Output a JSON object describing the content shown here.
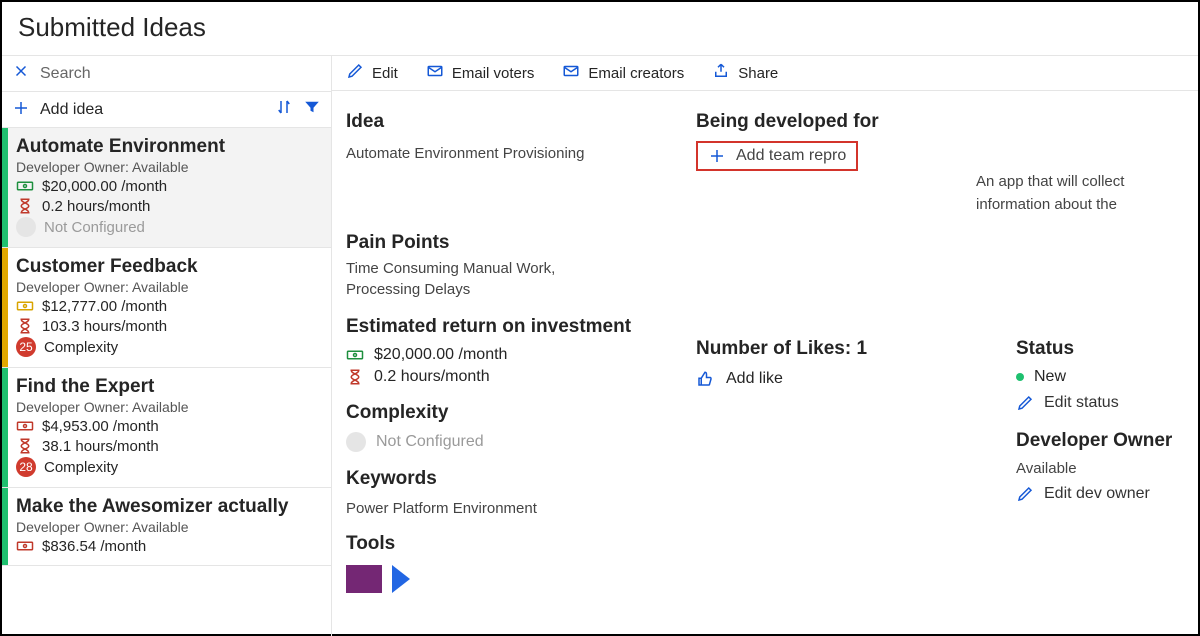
{
  "header": {
    "title": "Submitted Ideas"
  },
  "sidebar": {
    "search_placeholder": "Search",
    "add_idea_label": "Add idea",
    "items": [
      {
        "accent": "green",
        "title": "Automate Environment",
        "owner": "Developer Owner: Available",
        "cost": "$20,000.00 /month",
        "cost_color": "green",
        "hours": "0.2 hours/month",
        "complexity_label": "Not Configured",
        "complexity_badge": "",
        "selected": true
      },
      {
        "accent": "yellow",
        "title": "Customer Feedback",
        "owner": "Developer Owner: Available",
        "cost": "$12,777.00 /month",
        "cost_color": "yellow",
        "hours": "103.3 hours/month",
        "complexity_label": "Complexity",
        "complexity_badge": "25",
        "selected": false
      },
      {
        "accent": "green",
        "title": "Find the Expert",
        "owner": "Developer Owner: Available",
        "cost": "$4,953.00 /month",
        "cost_color": "red",
        "hours": "38.1 hours/month",
        "complexity_label": "Complexity",
        "complexity_badge": "28",
        "selected": false
      },
      {
        "accent": "green",
        "title": "Make the Awesomizer actually",
        "owner": "Developer Owner: Available",
        "cost": "$836.54 /month",
        "cost_color": "red",
        "hours": "",
        "complexity_label": "",
        "complexity_badge": "",
        "selected": false
      }
    ]
  },
  "toolbar": {
    "edit_label": "Edit",
    "email_voters_label": "Email voters",
    "email_creators_label": "Email creators",
    "share_label": "Share"
  },
  "detail": {
    "idea_heading": "Idea",
    "idea_value": "Automate Environment Provisioning",
    "pain_heading": "Pain Points",
    "pain_value": "Time Consuming Manual Work, Processing Delays",
    "dev_for_heading": "Being developed for",
    "add_team_label": "Add team repro",
    "description": "An app that will collect information about the",
    "roi_heading": "Estimated return on investment",
    "roi_cost": "$20,000.00 /month",
    "roi_hours": "0.2 hours/month",
    "complexity_heading": "Complexity",
    "complexity_value": "Not Configured",
    "keywords_heading": "Keywords",
    "keywords_value": "Power Platform Environment",
    "tools_heading": "Tools",
    "likes_heading": "Number of Likes: 1",
    "add_like_label": "Add like",
    "status_heading": "Status",
    "status_value": "New",
    "edit_status_label": "Edit status",
    "dev_owner_heading": "Developer Owner",
    "dev_owner_value": "Available",
    "edit_dev_owner_label": "Edit dev owner"
  }
}
